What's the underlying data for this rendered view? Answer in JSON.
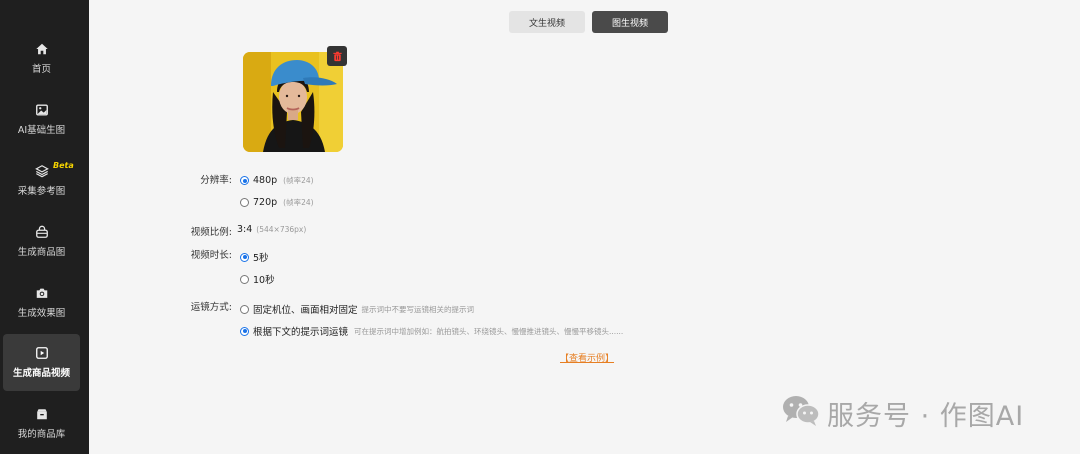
{
  "sidebar": {
    "items": [
      {
        "label": "首页",
        "icon": "home-icon"
      },
      {
        "label": "AI基础生图",
        "icon": "image-icon"
      },
      {
        "label": "采集参考图",
        "icon": "layers-icon",
        "badge": "Beta"
      },
      {
        "label": "生成商品图",
        "icon": "bag-icon"
      },
      {
        "label": "生成效果图",
        "icon": "camera-icon"
      },
      {
        "label": "生成商品视频",
        "icon": "video-icon",
        "active": true
      },
      {
        "label": "我的商品库",
        "icon": "box-icon"
      }
    ]
  },
  "tabs": [
    {
      "label": "文生视频",
      "active": false
    },
    {
      "label": "图生视频",
      "active": true
    }
  ],
  "form": {
    "resolution": {
      "label": "分辨率:",
      "options": [
        {
          "label": "480p",
          "hint": "(帧率24)",
          "selected": true
        },
        {
          "label": "720p",
          "hint": "(帧率24)",
          "selected": false
        }
      ]
    },
    "ratio": {
      "label": "视频比例:",
      "value": "3:4",
      "hint": "(544×736px)"
    },
    "duration": {
      "label": "视频时长:",
      "options": [
        {
          "label": "5秒",
          "selected": true
        },
        {
          "label": "10秒",
          "selected": false
        }
      ]
    },
    "camera": {
      "label": "运镜方式:",
      "options": [
        {
          "label": "固定机位、画面相对固定",
          "hint": "提示词中不要写运镜相关的提示词",
          "selected": false
        },
        {
          "label": "根据下文的提示词运镜",
          "hint": "可在提示词中增加例如：航拍镜头、环绕镜头、慢慢推进镜头、慢慢平移镜头......",
          "selected": true
        }
      ]
    },
    "example_link": "【查看示例】"
  },
  "watermark": {
    "text": "服务号 · 作图AI"
  },
  "colors": {
    "sidebar_bg": "#1f1f1f",
    "active_tab": "#4a4a4a",
    "radio_accent": "#1a73e8",
    "link": "#e67e22",
    "beta": "#f5d300"
  }
}
